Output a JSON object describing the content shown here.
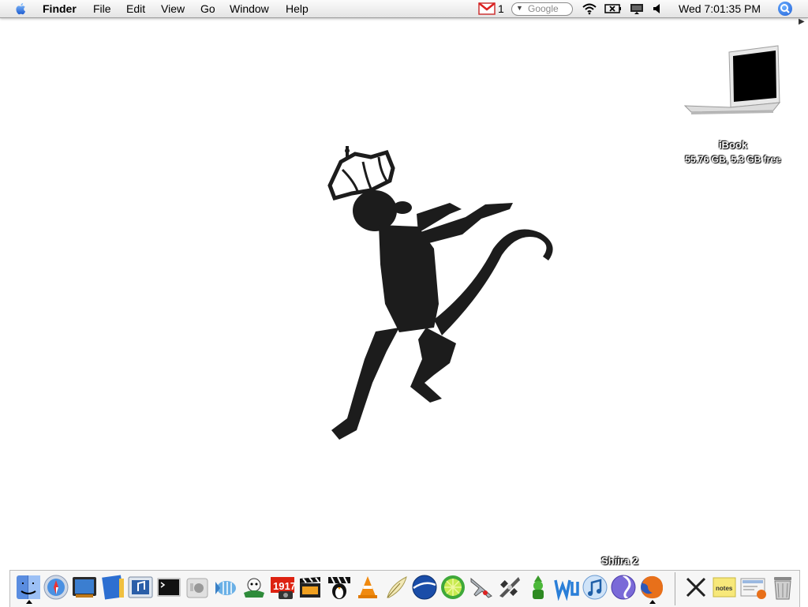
{
  "menubar": {
    "apple_icon": "apple-logo-icon",
    "app_name": "Finder",
    "menus": [
      "File",
      "Edit",
      "View",
      "Go",
      "Window",
      "Help"
    ],
    "gmail_icon": "gmail-icon",
    "gmail_count": "1",
    "google_placeholder": "Google",
    "tray_icons": [
      "wifi-icon",
      "battery-icon",
      "display-icon",
      "volume-icon"
    ],
    "clock": "Wed 7:01:35 PM",
    "spotlight_icon": "spotlight-search-icon"
  },
  "desktop": {
    "drive": {
      "icon": "ibook-laptop-icon",
      "name": "iBook",
      "info": "55.76 GB, 5.3 GB free"
    },
    "wallpaper": "crowned-monkey-silhouette"
  },
  "dock": {
    "hover_label": "Shiira 2",
    "apps": [
      {
        "icon": "finder-icon",
        "running": true
      },
      {
        "icon": "safari-compass-icon",
        "running": false
      },
      {
        "icon": "screen-icon",
        "running": false
      },
      {
        "icon": "blue-book-icon",
        "running": false
      },
      {
        "icon": "itunes-window-icon",
        "running": false
      },
      {
        "icon": "terminal-icon",
        "running": false
      },
      {
        "icon": "apple-gray-icon",
        "running": false
      },
      {
        "icon": "fish-icon",
        "running": false
      },
      {
        "icon": "toast-icon",
        "running": false
      },
      {
        "icon": "photo-1917-icon",
        "running": false
      },
      {
        "icon": "clapperboard-icon",
        "running": false
      },
      {
        "icon": "penguin-clapper-icon",
        "running": false
      },
      {
        "icon": "vlc-cone-icon",
        "running": false
      },
      {
        "icon": "quill-icon",
        "running": false
      },
      {
        "icon": "google-earth-icon",
        "running": false
      },
      {
        "icon": "lime-icon",
        "running": false
      },
      {
        "icon": "jet-fighter-icon",
        "running": false
      },
      {
        "icon": "spaceship-icon",
        "running": false
      },
      {
        "icon": "green-character-icon",
        "running": false
      },
      {
        "icon": "wu-logo-icon",
        "running": false
      },
      {
        "icon": "itunes-icon",
        "running": false
      },
      {
        "icon": "shiira-icon",
        "running": false
      },
      {
        "icon": "firefox-icon",
        "running": true
      }
    ],
    "extras": [
      {
        "icon": "x11-icon"
      },
      {
        "icon": "notes-icon",
        "label": "notes"
      },
      {
        "icon": "firefox-docs-icon"
      },
      {
        "icon": "trash-icon"
      }
    ]
  }
}
